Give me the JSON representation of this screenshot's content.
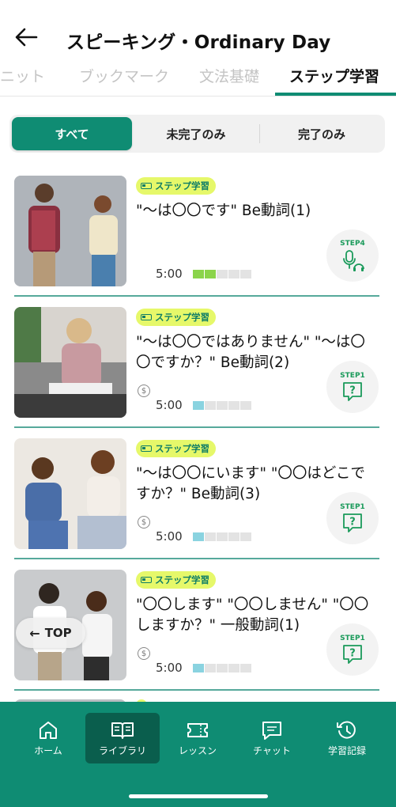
{
  "header": {
    "title": "スピーキング・Ordinary Day"
  },
  "tabs": [
    {
      "label": "ニット"
    },
    {
      "label": "ブックマーク"
    },
    {
      "label": "文法基礎"
    },
    {
      "label": "ステップ学習"
    }
  ],
  "filter": {
    "all": "すべて",
    "incomplete": "未完了のみ",
    "complete": "完了のみ"
  },
  "lessons": [
    {
      "tag": "ステップ学習",
      "title": "\"〜は〇〇です\" Be動詞(1)",
      "coin": "",
      "duration": "5:00",
      "progress": {
        "filled": 2,
        "total": 5,
        "color": "#8bd44b"
      },
      "step": "STEP4",
      "step_icon": "mic-headphones-icon"
    },
    {
      "tag": "ステップ学習",
      "title": "\"〜は〇〇ではありません\" \"〜は〇〇ですか？\" Be動詞(2)",
      "coin": "$",
      "duration": "5:00",
      "progress": {
        "filled": 1,
        "total": 5,
        "color": "#8ad3e0"
      },
      "step": "STEP1",
      "step_icon": "question-bubble-icon"
    },
    {
      "tag": "ステップ学習",
      "title": "\"〜は〇〇にいます\" \"〇〇はどこですか？\" Be動詞(3)",
      "coin": "$",
      "duration": "5:00",
      "progress": {
        "filled": 1,
        "total": 5,
        "color": "#8ad3e0"
      },
      "step": "STEP1",
      "step_icon": "question-bubble-icon"
    },
    {
      "tag": "ステップ学習",
      "title": "\"〇〇します\" \"〇〇しません\" \"〇〇しますか？\" 一般動詞(1)",
      "coin": "$",
      "duration": "5:00",
      "progress": {
        "filled": 1,
        "total": 5,
        "color": "#8ad3e0"
      },
      "step": "STEP1",
      "step_icon": "question-bubble-icon"
    }
  ],
  "top_button": "TOP",
  "nav": [
    {
      "label": "ホーム",
      "icon": "home-icon"
    },
    {
      "label": "ライブラリ",
      "icon": "book-icon"
    },
    {
      "label": "レッスン",
      "icon": "ticket-icon"
    },
    {
      "label": "チャット",
      "icon": "chat-icon"
    },
    {
      "label": "学習記録",
      "icon": "history-icon"
    }
  ],
  "colors": {
    "accent": "#0f8c73",
    "tag_bg": "#e6f86a"
  }
}
